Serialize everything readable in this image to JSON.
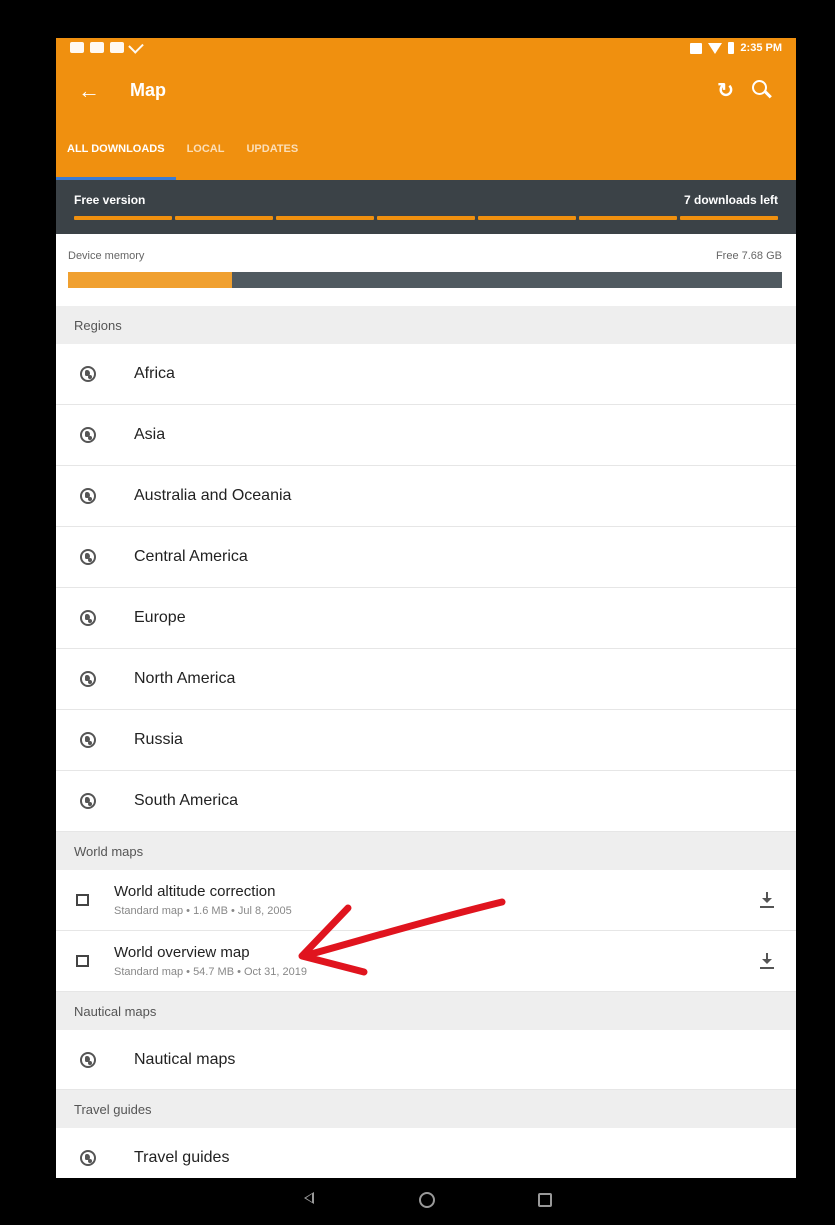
{
  "status_bar": {
    "time": "2:35 PM"
  },
  "app_bar": {
    "title": "Map",
    "tabs": [
      {
        "label": "ALL DOWNLOADS",
        "active": true
      },
      {
        "label": "LOCAL",
        "active": false
      },
      {
        "label": "UPDATES",
        "active": false
      }
    ]
  },
  "free_bar": {
    "label": "Free version",
    "downloads_left": "7 downloads left",
    "segments_total": 7,
    "segments_remaining": 7
  },
  "memory": {
    "label": "Device memory",
    "free": "Free 7.68 GB",
    "used_fraction": 0.23
  },
  "sections": {
    "regions": "Regions",
    "world_maps": "World maps",
    "nautical_maps": "Nautical maps",
    "travel_guides": "Travel guides"
  },
  "regions": [
    {
      "label": "Africa"
    },
    {
      "label": "Asia"
    },
    {
      "label": "Australia and Oceania"
    },
    {
      "label": "Central America"
    },
    {
      "label": "Europe"
    },
    {
      "label": "North America"
    },
    {
      "label": "Russia"
    },
    {
      "label": "South America"
    }
  ],
  "world_maps": [
    {
      "title": "World altitude correction",
      "subtitle": "Standard map • 1.6 MB • Jul 8, 2005"
    },
    {
      "title": "World overview map",
      "subtitle": "Standard map • 54.7 MB • Oct 31, 2019"
    }
  ],
  "nautical": {
    "label": "Nautical maps"
  },
  "travel": {
    "label": "Travel guides"
  },
  "colors": {
    "accent": "#f0900f",
    "dark_bar": "#3b4247",
    "annotation_arrow": "#e0141e"
  },
  "icons": {
    "back": "arrow-left-icon",
    "refresh": "refresh-icon",
    "search": "search-icon",
    "region": "globe-icon",
    "map": "map-icon",
    "download": "download-icon"
  }
}
